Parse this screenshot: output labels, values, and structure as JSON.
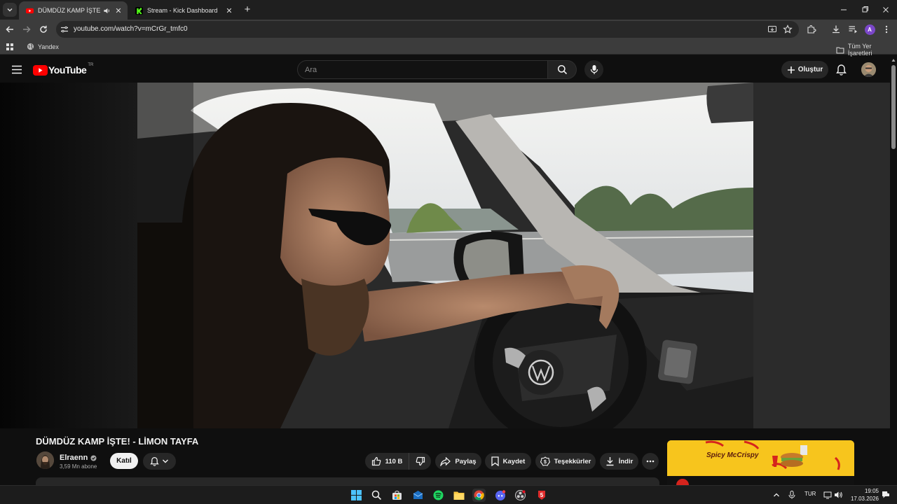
{
  "browser": {
    "tabs": [
      {
        "title": "DÜMDÜZ KAMP İŞTE! - LİMON TAYFA",
        "active": true,
        "favicon": "youtube-icon",
        "audio": true
      },
      {
        "title": "Stream - Kick Dashboard",
        "active": false,
        "favicon": "kick-icon"
      }
    ],
    "url": "youtube.com/watch?v=mCrGr_tmfc0",
    "bookmarks": [
      {
        "label": "Yandex",
        "icon": "globe-icon"
      }
    ],
    "all_bookmarks_label": "Tüm Yer İşaretleri",
    "profile_initial": "A",
    "colors": {
      "chrome_dark": "#1f1f1f",
      "toolbar": "#3c3c3c",
      "profile": "#7b47c9"
    }
  },
  "youtube": {
    "logo_text": "YouTube",
    "region": "TR",
    "search_placeholder": "Ara",
    "create_label": "Oluştur",
    "video": {
      "title": "DÜMDÜZ KAMP İŞTE! - LİMON TAYFA",
      "channel": "Elraenn",
      "verified": true,
      "subscribers": "3,59 Mn abone",
      "join_label": "Katıl",
      "likes": "110 B",
      "share_label": "Paylaş",
      "save_label": "Kaydet",
      "thanks_label": "Teşekkürler",
      "download_label": "İndir"
    },
    "ad": {
      "headline": "Spicy McCrispy",
      "brand_color": "#f7c51d"
    },
    "colors": {
      "red": "#ff0000",
      "bg": "#0f0f0f",
      "pill": "#272727"
    }
  },
  "taskbar": {
    "apps": [
      "windows-start-icon",
      "search-icon",
      "store-icon",
      "mail-icon",
      "spotify-icon",
      "file-explorer-icon",
      "chrome-icon",
      "discord-icon",
      "obs-icon",
      "app-red-icon"
    ],
    "language": "TUR",
    "time": "19:05",
    "date": "17.03.2026"
  }
}
